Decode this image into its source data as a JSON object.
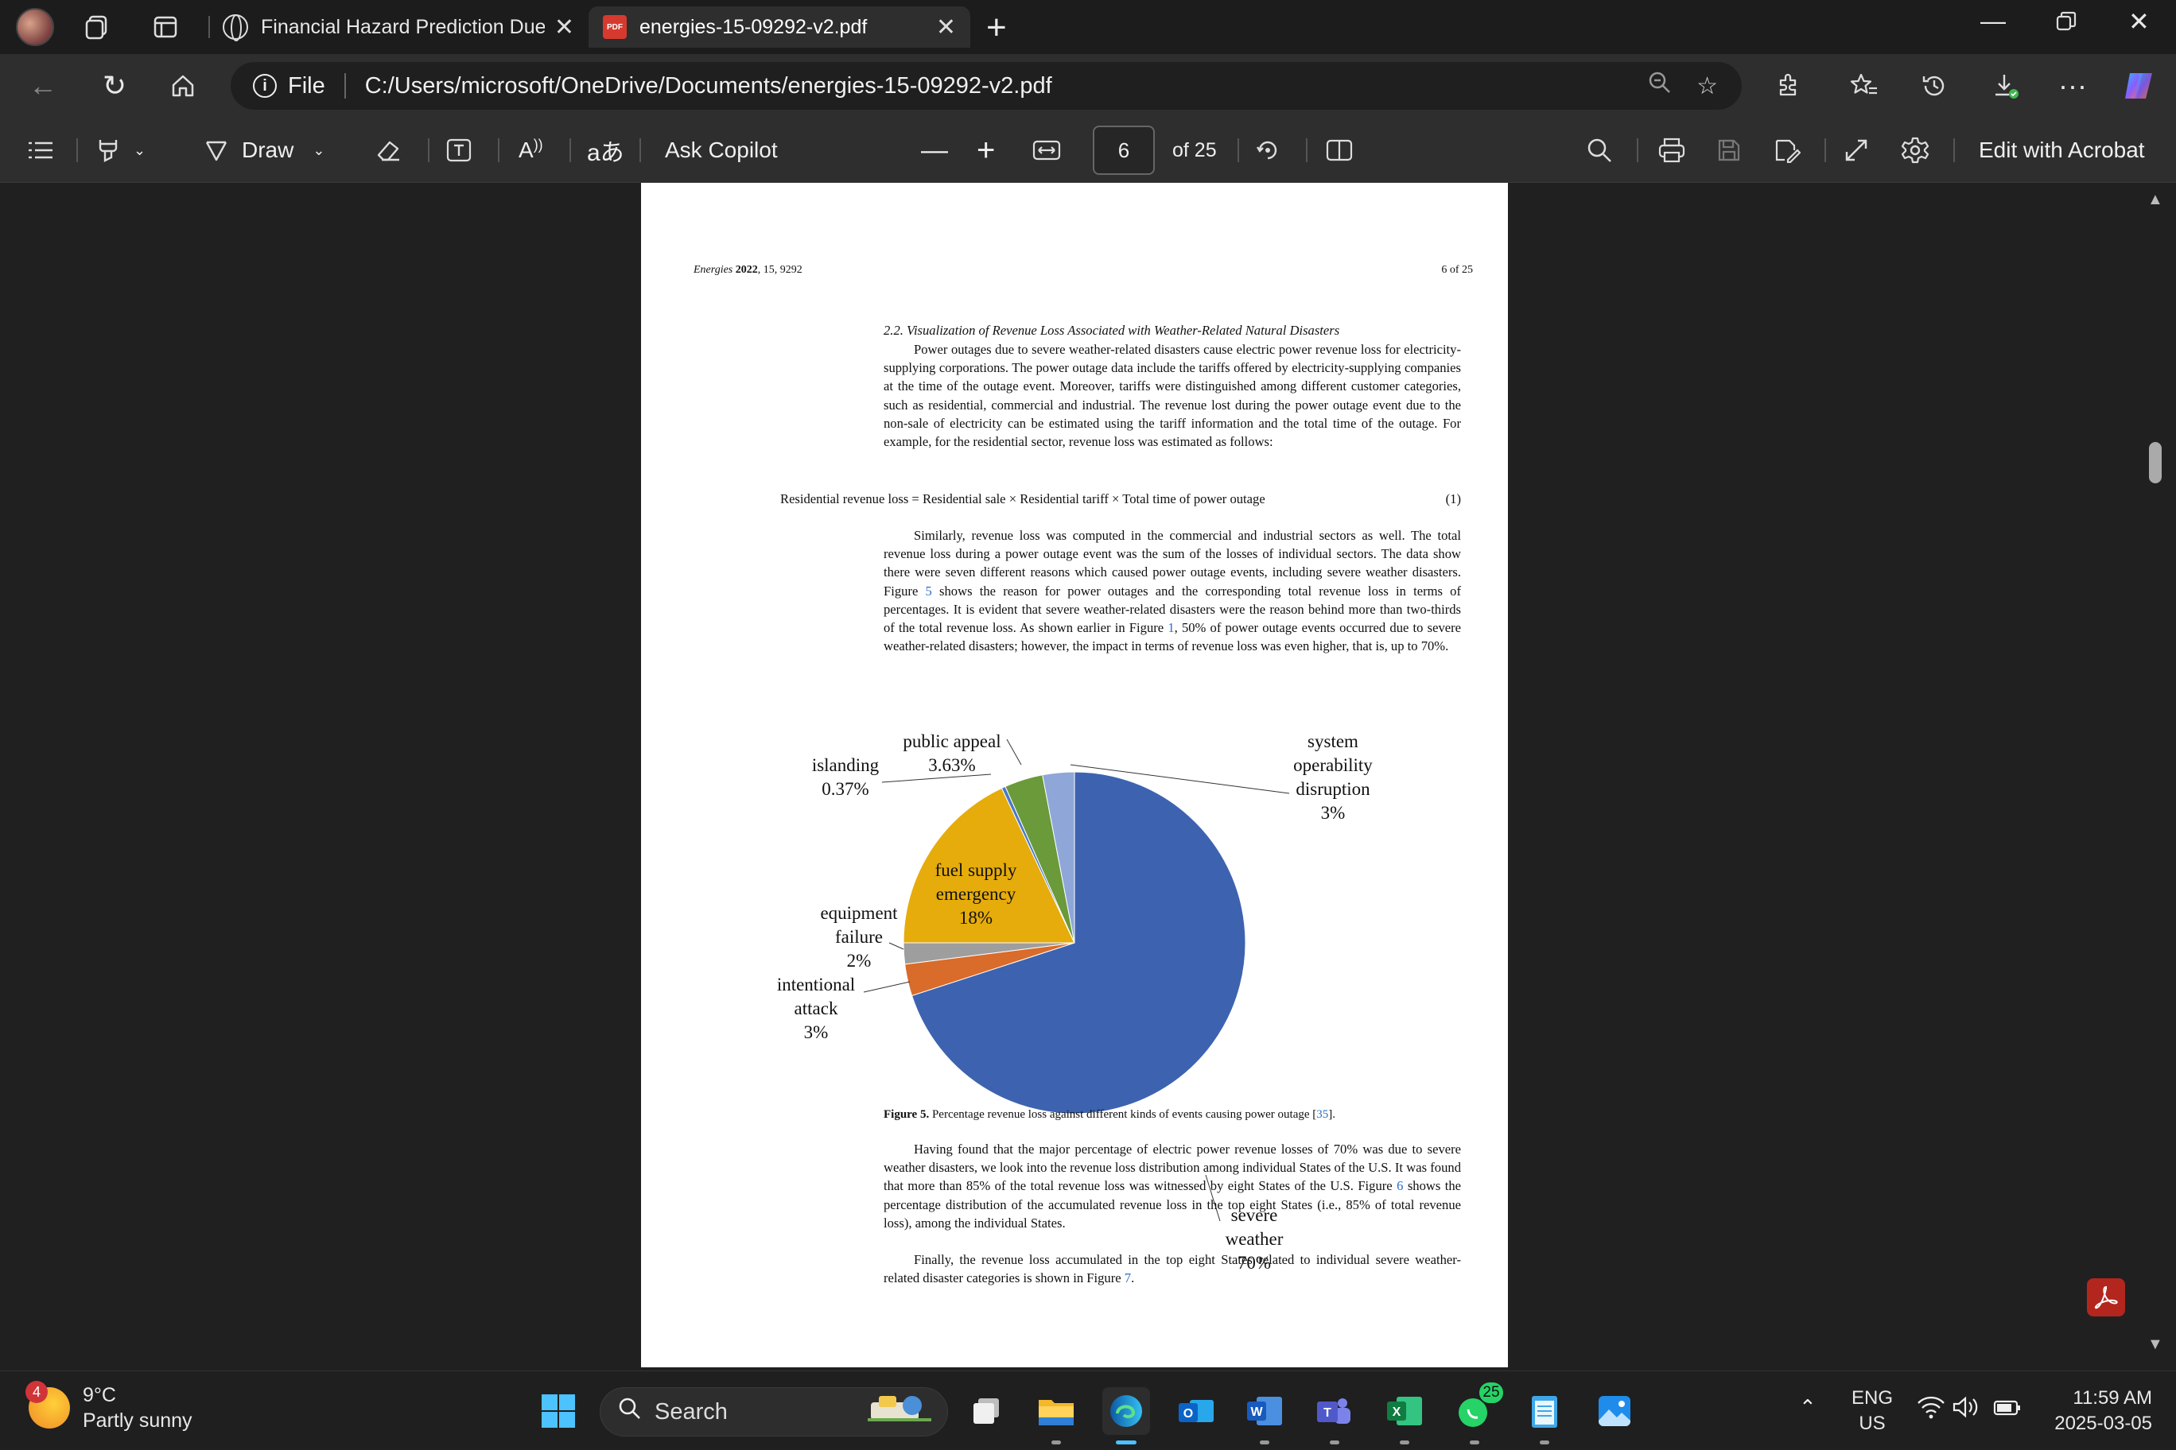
{
  "tabs": [
    {
      "title": "Financial Hazard Prediction Due t",
      "close": "✕"
    },
    {
      "title": "energies-15-09292-v2.pdf",
      "close": "✕"
    }
  ],
  "address": {
    "file_label": "File",
    "url": "C:/Users/microsoft/OneDrive/Documents/energies-15-09292-v2.pdf"
  },
  "pdf_toolbar": {
    "draw_label": "Draw",
    "copilot_label": "Ask Copilot",
    "current_page": "6",
    "page_count": "of 25",
    "edit_label": "Edit with Acrobat"
  },
  "pdf_page": {
    "header_left_journal": "Energies",
    "header_left_year": "2022",
    "header_left_rest": ", 15, 9292",
    "header_right": "6 of 25",
    "section_heading": "2.2. Visualization of Revenue Loss Associated with Weather-Related Natural Disasters",
    "para1": "Power outages due to severe weather-related disasters cause electric power revenue loss for electricity-supplying corporations. The power outage data include the tariffs offered by electricity-supplying companies at the time of the outage event. Moreover, tariffs were distinguished among different customer categories, such as residential, commercial and industrial. The revenue lost during the power outage event due to the non-sale of electricity can be estimated using the tariff information and the total time of the outage. For example, for the residential sector, revenue loss was estimated as follows:",
    "equation": "Residential revenue loss = Residential sale × Residential tariff × Total time of power outage",
    "equation_number": "(1)",
    "para2_a": "Similarly, revenue loss was computed in the commercial and industrial sectors as well. The total revenue loss during a power outage event was the sum of the losses of individual sectors. The data show there were seven different reasons which caused power outage events, including severe weather disasters. Figure ",
    "para2_ref1": "5",
    "para2_b": " shows the reason for power outages and the corresponding total revenue loss in terms of percentages. It is evident that severe weather-related disasters were the reason behind more than two-thirds of the total revenue loss. As shown earlier in Figure ",
    "para2_ref2": "1",
    "para2_c": ", 50% of power outage events occurred due to severe weather-related disasters; however, the impact in terms of revenue loss was even higher, that is, up to 70%.",
    "caption_label": "Figure 5.",
    "caption_text": " Percentage revenue loss against different kinds of events causing power outage [",
    "caption_ref": "35",
    "caption_end": "].",
    "para3_a": "Having found that the major percentage of electric power revenue losses of 70% was due to severe weather disasters, we look into the revenue loss distribution among individual States of the U.S. It was found that more than 85% of the total revenue loss was witnessed by eight States of the U.S. Figure ",
    "para3_ref": "6",
    "para3_b": " shows the percentage distribution of the accumulated revenue loss in the top eight States (i.e., 85% of total revenue loss), among the individual States.",
    "para4_a": "Finally, the revenue loss accumulated in the top eight States related to individual severe weather-related disaster categories is shown in Figure ",
    "para4_ref": "7",
    "para4_b": "."
  },
  "chart_data": {
    "type": "pie",
    "title": "",
    "slices": [
      {
        "label": "severe weather",
        "value": 70,
        "display": "70%",
        "color": "#3d63b0"
      },
      {
        "label": "intentional attack",
        "value": 3,
        "display": "3%",
        "color": "#d96b2b"
      },
      {
        "label": "equipment failure",
        "value": 2,
        "display": "2%",
        "color": "#9e9e9e"
      },
      {
        "label": "fuel supply emergency",
        "value": 18,
        "display": "18%",
        "color": "#e6ac0c"
      },
      {
        "label": "islanding",
        "value": 0.37,
        "display": "0.37%",
        "color": "#4a79c7"
      },
      {
        "label": "public appeal",
        "value": 3.63,
        "display": "3.63%",
        "color": "#6a9a3a"
      },
      {
        "label": "system operability disruption",
        "value": 3,
        "display": "3%",
        "color": "#8fa6d8"
      }
    ]
  },
  "taskbar": {
    "weather_badge": "4",
    "temperature": "9°C",
    "condition": "Partly sunny",
    "search_placeholder": "Search",
    "whatsapp_badge": "25",
    "lang_1": "ENG",
    "lang_2": "US",
    "time": "11:59 AM",
    "date": "2025-03-05"
  },
  "colors": {
    "acrobat_red": "#b3261e",
    "pdf_badge": "#d63a2e"
  }
}
